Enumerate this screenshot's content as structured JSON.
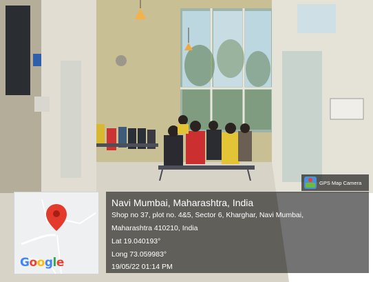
{
  "overlay": {
    "app_badge": "GPS Map Camera",
    "city": "Navi Mumbai, Maharashtra, India",
    "address_line1": "Shop no 37, plot no. 4&5, Sector 6, Kharghar, Navi Mumbai,",
    "address_line2": "Maharashtra 410210, India",
    "latitude": "Lat 19.040193°",
    "longitude": "Long 73.059983°",
    "datetime": "19/05/22 01:14 PM"
  },
  "map": {
    "logo_text": "Google",
    "pin_color": "#e33a2c",
    "logo_colors": [
      "#4285f4",
      "#ea4335",
      "#fbbc05",
      "#4285f4",
      "#34a853",
      "#ea4335"
    ]
  },
  "colors": {
    "wall": "#c9c1a6",
    "floor": "#d7d2c6",
    "window_glass": "#bcd7e0",
    "ceiling": "#e8e3d4"
  }
}
